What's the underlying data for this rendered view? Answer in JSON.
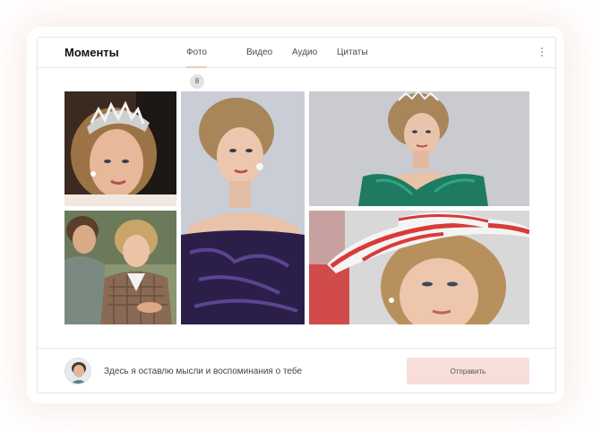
{
  "header": {
    "title": "Моменты",
    "tabs": [
      {
        "label": "Фото",
        "count": "8",
        "active": true
      },
      {
        "label": "Видео"
      },
      {
        "label": "Аудио"
      },
      {
        "label": "Цитаты"
      }
    ],
    "more_icon": "more-vertical-icon"
  },
  "gallery": {
    "photos": [
      {
        "name": "photo-tiara-portrait"
      },
      {
        "name": "photo-short-hair-gown"
      },
      {
        "name": "photo-green-gown-tiara"
      },
      {
        "name": "photo-couple-outdoors"
      },
      {
        "name": "photo-red-white-hat"
      }
    ]
  },
  "footer": {
    "input_value": "Здесь я оставлю мысли и воспоминания о тебе",
    "send_label": "Отправить"
  },
  "colors": {
    "accent": "#f8dedb",
    "tab_underline": "#f0c8c2",
    "badge_bg": "#e2e2e2"
  }
}
